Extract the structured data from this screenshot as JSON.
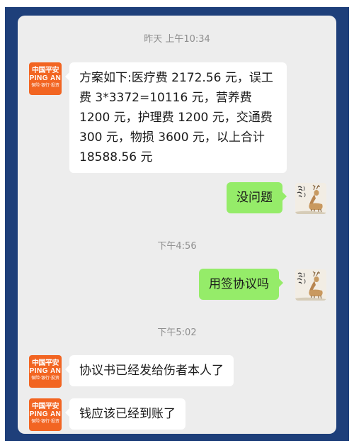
{
  "chat": {
    "messages": [
      {
        "id": "ts1",
        "kind": "timestamp",
        "text": "昨天 上午10:34"
      },
      {
        "id": "m1",
        "kind": "incoming",
        "sender": "pingan",
        "text": "方案如下:医疗费 2172.56 元，误工费 3*3372=10116 元，营养费 1200 元，护理费 1200 元，交通费 300 元，物损 3600 元，以上合计 18588.56 元"
      },
      {
        "id": "m2",
        "kind": "outgoing",
        "text": "没问题"
      },
      {
        "id": "ts2",
        "kind": "timestamp",
        "text": "下午4:56"
      },
      {
        "id": "m3",
        "kind": "outgoing",
        "text": "用签协议吗"
      },
      {
        "id": "ts3",
        "kind": "timestamp",
        "text": "下午5:02"
      },
      {
        "id": "m4",
        "kind": "incoming",
        "sender": "pingan",
        "text": "协议书已经发给伤者本人了"
      },
      {
        "id": "m5",
        "kind": "incoming",
        "sender": "pingan",
        "text": "钱应该已经到账了"
      }
    ]
  },
  "avatars": {
    "pingan": {
      "line1": "中国平安",
      "line2": "PING AN",
      "line3": "保险·银行·投资",
      "color": "#f26522",
      "icon": "pingan-logo"
    },
    "self": {
      "icon": "deer-painting-avatar"
    }
  },
  "colors": {
    "frame": "#1e3f7a",
    "background": "#ededed",
    "incoming_bubble": "#ffffff",
    "outgoing_bubble": "#95ec69",
    "timestamp_text": "#8e8e8e"
  }
}
